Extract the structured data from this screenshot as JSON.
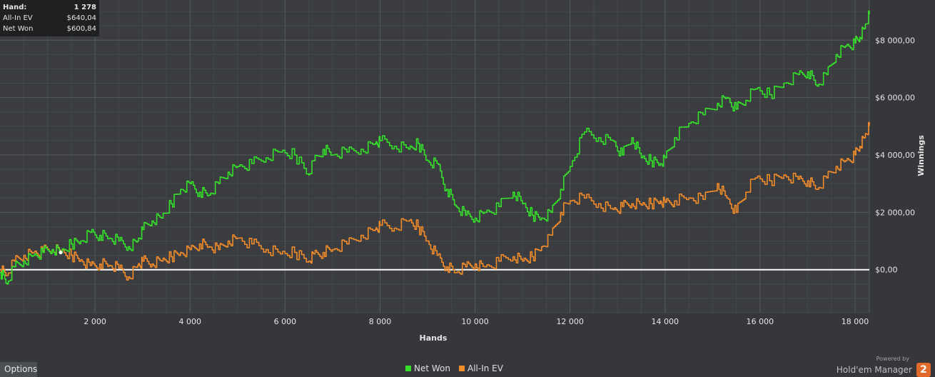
{
  "tooltip": {
    "hand_label": "Hand:",
    "hand_value": "1 278",
    "ev_label": "All-In EV",
    "ev_value": "$640,04",
    "net_label": "Net Won",
    "net_value": "$600,84"
  },
  "options_label": "Options",
  "branding": {
    "powered_by": "Powered by",
    "product": "Hold'em Manager",
    "logo_text": "2"
  },
  "chart_data": {
    "type": "line",
    "xlabel": "Hands",
    "ylabel": "Winnings",
    "xlim": [
      0,
      18300
    ],
    "ylim": [
      -1500,
      9400
    ],
    "x_ticks": [
      2000,
      4000,
      6000,
      8000,
      10000,
      12000,
      14000,
      16000,
      18000
    ],
    "x_tick_labels": [
      "2 000",
      "4 000",
      "6 000",
      "8 000",
      "10 000",
      "12 000",
      "14 000",
      "16 000",
      "18 000"
    ],
    "y_ticks": [
      0,
      2000,
      4000,
      6000,
      8000
    ],
    "y_tick_labels": [
      "$0,00",
      "$2 000,00",
      "$4 000,00",
      "$6 000,00",
      "$8 000,00"
    ],
    "grid": true,
    "legend_position": "bottom-center",
    "series": [
      {
        "name": "Net Won",
        "color": "#35e02a",
        "x": [
          0,
          150,
          300,
          500,
          700,
          900,
          1100,
          1278,
          1500,
          1700,
          1900,
          2100,
          2300,
          2500,
          2700,
          2900,
          3000,
          3200,
          3400,
          3600,
          3800,
          4000,
          4200,
          4400,
          4600,
          4800,
          5000,
          5300,
          5600,
          5900,
          6200,
          6500,
          6600,
          6800,
          7000,
          7300,
          7600,
          7900,
          8000,
          8300,
          8600,
          8800,
          9000,
          9200,
          9400,
          9600,
          9800,
          10000,
          10200,
          10500,
          10800,
          11000,
          11200,
          11400,
          11600,
          11800,
          12000,
          12300,
          12600,
          12900,
          13100,
          13300,
          13500,
          13700,
          13900,
          14000,
          14200,
          14500,
          14800,
          15100,
          15300,
          15500,
          15700,
          15900,
          16200,
          16500,
          16800,
          17000,
          17200,
          17400,
          17600,
          17800,
          18000,
          18100,
          18200,
          18300
        ],
        "values": [
          -100,
          -500,
          100,
          300,
          500,
          600,
          700,
          600,
          900,
          1000,
          1300,
          1200,
          1100,
          1000,
          800,
          1000,
          1400,
          1700,
          1800,
          2300,
          2800,
          3000,
          2700,
          2600,
          3000,
          3400,
          3600,
          3700,
          3900,
          4100,
          4000,
          3300,
          3800,
          4200,
          4000,
          4100,
          4200,
          4400,
          4500,
          4300,
          4200,
          4400,
          3800,
          3700,
          2800,
          2200,
          1900,
          1800,
          2000,
          2200,
          2700,
          2300,
          1900,
          1800,
          2000,
          2800,
          3600,
          4800,
          4600,
          4500,
          4000,
          4600,
          3900,
          3800,
          3700,
          3900,
          4600,
          5100,
          5400,
          5800,
          6000,
          5600,
          5900,
          6300,
          6100,
          6500,
          6800,
          6900,
          6400,
          6800,
          7500,
          7800,
          7900,
          8100,
          8400,
          8900
        ]
      },
      {
        "name": "All-In EV",
        "color": "#f28c2a",
        "x": [
          0,
          150,
          300,
          500,
          700,
          900,
          1100,
          1278,
          1500,
          1700,
          1900,
          2100,
          2300,
          2500,
          2700,
          2900,
          3000,
          3200,
          3400,
          3600,
          3800,
          4000,
          4200,
          4400,
          4600,
          4800,
          5000,
          5300,
          5600,
          5900,
          6200,
          6500,
          6600,
          6800,
          7000,
          7300,
          7600,
          7900,
          8000,
          8300,
          8600,
          8800,
          9000,
          9200,
          9400,
          9600,
          9800,
          10000,
          10200,
          10500,
          10800,
          11000,
          11200,
          11400,
          11600,
          11800,
          12000,
          12300,
          12600,
          12900,
          13100,
          13300,
          13500,
          13700,
          13900,
          14000,
          14200,
          14500,
          14800,
          15100,
          15300,
          15500,
          15700,
          15900,
          16200,
          16500,
          16800,
          17000,
          17200,
          17400,
          17600,
          17800,
          18000,
          18100,
          18200,
          18300
        ],
        "values": [
          0,
          -200,
          300,
          500,
          600,
          650,
          700,
          640,
          500,
          350,
          150,
          200,
          150,
          50,
          -250,
          150,
          300,
          200,
          300,
          450,
          600,
          700,
          900,
          800,
          700,
          1000,
          1100,
          900,
          700,
          550,
          600,
          300,
          550,
          600,
          700,
          900,
          1200,
          1400,
          1550,
          1450,
          1700,
          1500,
          1000,
          500,
          100,
          -100,
          100,
          200,
          100,
          300,
          450,
          300,
          450,
          800,
          1200,
          2000,
          2400,
          2500,
          2300,
          2100,
          2200,
          2300,
          2250,
          2300,
          2400,
          2350,
          2400,
          2500,
          2450,
          3000,
          2500,
          2000,
          2700,
          3200,
          3100,
          3300,
          3150,
          3100,
          2800,
          3200,
          3600,
          3800,
          4000,
          4300,
          4600,
          5000
        ]
      }
    ]
  }
}
